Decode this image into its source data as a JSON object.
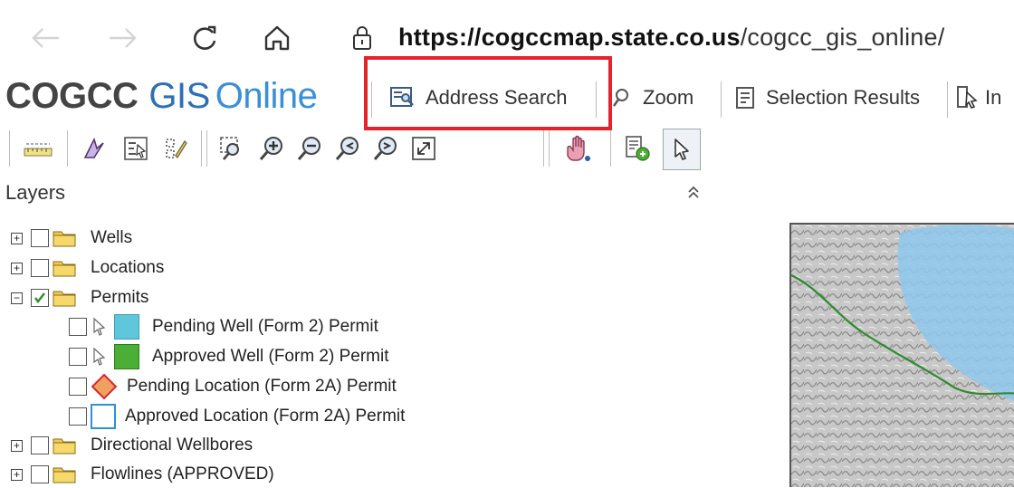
{
  "browser": {
    "url_domain": "https://cogccmap.state.co.us",
    "url_path": "/cogcc_gis_online/",
    "icons": [
      "back-arrow-icon",
      "forward-arrow-icon",
      "refresh-icon",
      "home-icon",
      "lock-icon"
    ]
  },
  "app": {
    "brand_a": "COGCC",
    "brand_b": "GIS",
    "brand_c": "Online"
  },
  "toolbar": {
    "address_search_label": "Address Search",
    "zoom_label": "Zoom",
    "selection_results_label": "Selection Results",
    "identify_label": "In"
  },
  "tools": [
    "measure-icon",
    "draw-icon",
    "select-by-attribute-icon",
    "edit-select-icon",
    "zoom-to-rectangle-icon",
    "zoom-in-icon",
    "zoom-out-icon",
    "zoom-previous-icon",
    "zoom-next-icon",
    "full-extent-icon",
    "pan-hand-icon",
    "layer-info-icon",
    "pointer-icon"
  ],
  "layers": {
    "header": "Layers",
    "items": [
      {
        "label": "Wells",
        "expander": "+",
        "checked": false
      },
      {
        "label": "Locations",
        "expander": "+",
        "checked": false
      },
      {
        "label": "Permits",
        "expander": "−",
        "checked": true
      },
      {
        "label": "Pending Well (Form 2) Permit",
        "checked": false,
        "swatch_color": "#5fc6dc"
      },
      {
        "label": "Approved Well (Form 2) Permit",
        "checked": false,
        "swatch_color": "#4caf35"
      },
      {
        "label": "Pending Location (Form 2A) Permit",
        "checked": false,
        "swatch_color": "#f0a060"
      },
      {
        "label": "Approved Location (Form 2A) Permit",
        "checked": false,
        "swatch_color": "#2f8fd8"
      },
      {
        "label": "Directional Wellbores",
        "expander": "+",
        "checked": false
      },
      {
        "label": "Flowlines (APPROVED)",
        "expander": "+",
        "checked": false
      }
    ]
  },
  "colors": {
    "highlight": "#e5232b",
    "brand_blue": "#2e6fb8",
    "folder": "#f2c94c",
    "water": "#8fc8ec"
  }
}
